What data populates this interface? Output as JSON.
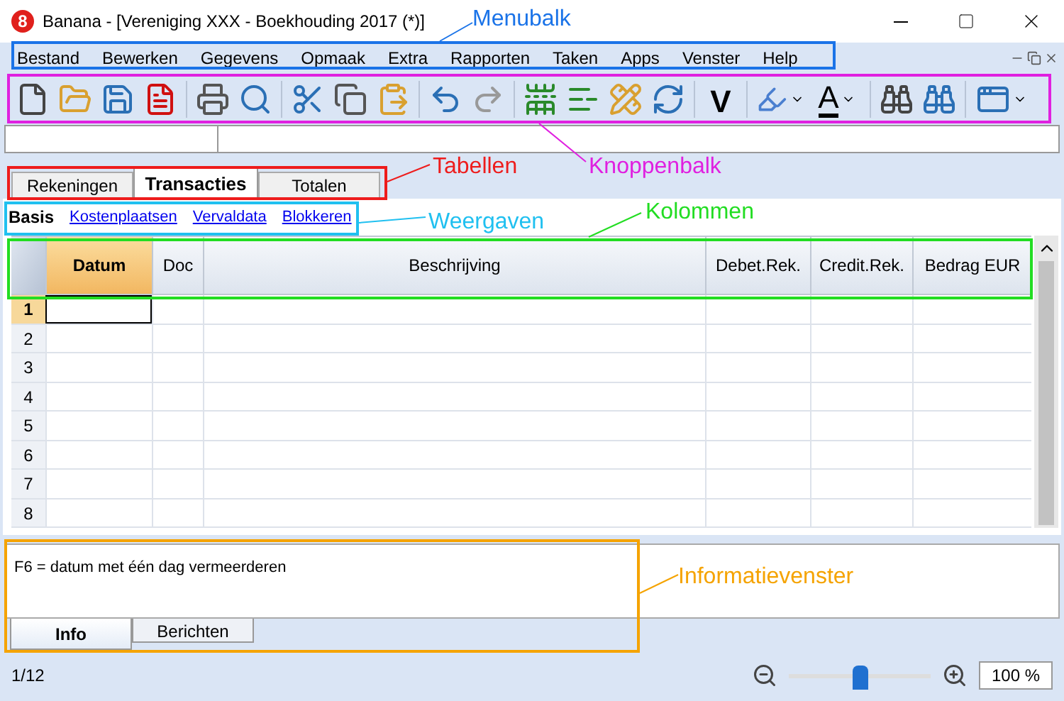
{
  "window": {
    "title": "Banana - [Vereniging XXX - Boekhouding 2017 (*)]",
    "logo": "8"
  },
  "menu": [
    "Bestand",
    "Bewerken",
    "Gegevens",
    "Opmaak",
    "Extra",
    "Rapporten",
    "Taken",
    "Apps",
    "Venster",
    "Help"
  ],
  "toolbar": {
    "validate_glyph": "V",
    "font_color_glyph": "A"
  },
  "tabs": [
    {
      "label": "Rekeningen",
      "selected": false
    },
    {
      "label": "Transacties",
      "selected": true
    },
    {
      "label": "Totalen",
      "selected": false
    }
  ],
  "views": [
    {
      "label": "Basis",
      "selected": true
    },
    {
      "label": "Kostenplaatsen",
      "selected": false
    },
    {
      "label": "Vervaldata",
      "selected": false
    },
    {
      "label": "Blokkeren",
      "selected": false
    }
  ],
  "table": {
    "columns": [
      {
        "label": "Datum",
        "selected": true
      },
      {
        "label": "Doc",
        "selected": false
      },
      {
        "label": "Beschrijving",
        "selected": false
      },
      {
        "label": "Debet.Rek.",
        "selected": false
      },
      {
        "label": "Credit.Rek.",
        "selected": false
      },
      {
        "label": "Bedrag EUR",
        "selected": false
      }
    ],
    "rows": [
      {
        "number": "1",
        "selected": true
      },
      {
        "number": "2",
        "selected": false
      },
      {
        "number": "3",
        "selected": false
      },
      {
        "number": "4",
        "selected": false
      },
      {
        "number": "5",
        "selected": false
      },
      {
        "number": "6",
        "selected": false
      },
      {
        "number": "7",
        "selected": false
      },
      {
        "number": "8",
        "selected": false
      }
    ]
  },
  "info": {
    "text": "F6 = datum met één dag vermeerderen",
    "tabs": [
      {
        "label": "Info",
        "selected": true
      },
      {
        "label": "Berichten",
        "selected": false
      }
    ]
  },
  "status_bar": {
    "position": "1/12",
    "zoom": {
      "level": 0.5,
      "value": "100 %"
    }
  },
  "annotations": [
    {
      "label": "Menubalk",
      "color": "#1a73e8"
    },
    {
      "label": "Knoppenbalk",
      "color": "#e020e0"
    },
    {
      "label": "Tabellen",
      "color": "#ee1c1c"
    },
    {
      "label": "Weergaven",
      "color": "#20c0f0"
    },
    {
      "label": "Kolommen",
      "color": "#22dd22"
    },
    {
      "label": "Informatievenster",
      "color": "#f5a300"
    }
  ]
}
